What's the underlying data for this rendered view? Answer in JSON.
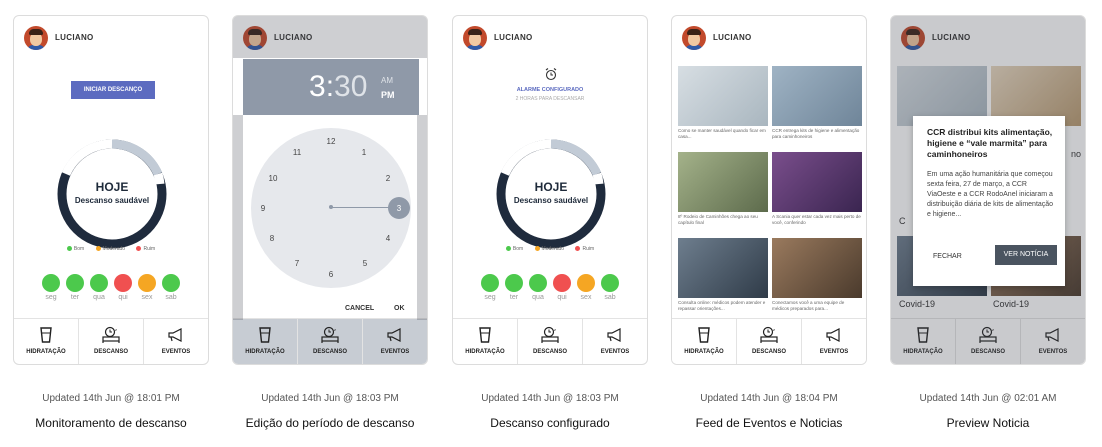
{
  "user": {
    "name": "LUCIANO"
  },
  "nav": {
    "items": [
      {
        "label": "HIDRATAÇÃO",
        "icon": "glass-icon"
      },
      {
        "label": "DESCANSO",
        "icon": "bed-clock-icon"
      },
      {
        "label": "EVENTOS",
        "icon": "megaphone-icon"
      }
    ]
  },
  "legend": {
    "good": "Bom",
    "moderate": "Moderado",
    "bad": "Ruim",
    "good_color": "#4cc94c",
    "moderate_color": "#f5a623",
    "bad_color": "#f05050"
  },
  "week": [
    {
      "label": "seg",
      "status": "good"
    },
    {
      "label": "ter",
      "status": "good"
    },
    {
      "label": "qua",
      "status": "good"
    },
    {
      "label": "qui",
      "status": "bad"
    },
    {
      "label": "sex",
      "status": "moderate"
    },
    {
      "label": "sab",
      "status": "good"
    }
  ],
  "ring": {
    "title": "HOJE",
    "subtitle": "Descanso saudável"
  },
  "screens": [
    {
      "title": "Monitoramento de descanso",
      "updated": "Updated 14th Jun @ 18:01 PM",
      "button": "INICIAR DESCANÇO"
    },
    {
      "title": "Edição do período de descanso",
      "updated": "Updated 14th Jun @ 18:03 PM",
      "time": {
        "hour": "3",
        "minute": "30",
        "am": "AM",
        "pm": "PM"
      },
      "dial": [
        "12",
        "1",
        "2",
        "3",
        "4",
        "5",
        "6",
        "7",
        "8",
        "9",
        "10",
        "11"
      ],
      "cancel": "CANCEL",
      "ok": "OK"
    },
    {
      "title": "Descanso configurado",
      "updated": "Updated 14th Jun @ 18:03 PM",
      "alarm_title": "ALARME CONFIGURADO",
      "alarm_sub": "2 HORAS PARA DESCANSAR"
    },
    {
      "title": "Feed de Eventos e Noticias",
      "updated": "Updated 14th Jun @ 18:04 PM",
      "cards": [
        {
          "text": "Como se manter saudável quando ficar em casa...",
          "color": "#b9c4cc"
        },
        {
          "text": "CCR entrega kits de higiene e alimentação para caminhoneiros",
          "color": "#8aa0b4"
        },
        {
          "text": "8º Rodeio de Caminhões chega ao seu capítulo final",
          "color": "#7a8a6a"
        },
        {
          "text": "A Scania quer estar cada vez mais perto de você, conferindo",
          "color": "#5a3a6a"
        },
        {
          "text": "Consulta online: médicos podem atender e repassar orientações...",
          "color": "#4a5a6a"
        },
        {
          "text": "Conectamos você a uma equipe de médicos preparados para...",
          "color": "#6a5444"
        }
      ]
    },
    {
      "title": "Preview Noticia",
      "updated": "Updated 14th Jun @ 02:01 AM",
      "modal_title": "CCR distribui kits alimentação, higiene e “vale marmita” para caminhoneiros",
      "modal_body": "Em uma ação humanitária que começou sexta feira, 27 de março, a CCR ViaOeste e a CCR RodoAnel iniciaram a distribuição diária de kits de alimentação e higiene...",
      "close": "FECHAR",
      "view": "VER NOTÍCIA",
      "bg_labels": [
        "Covid-19",
        "Covid-19"
      ],
      "bg_fragments": [
        "no",
        "C"
      ]
    }
  ],
  "colors": {
    "accent": "#5c6bc0",
    "ring_dark": "#1f2b3d",
    "ring_light": "#c2cbd6",
    "dial_bg": "#e6e8ec",
    "header_dark": "#8f99a8"
  }
}
